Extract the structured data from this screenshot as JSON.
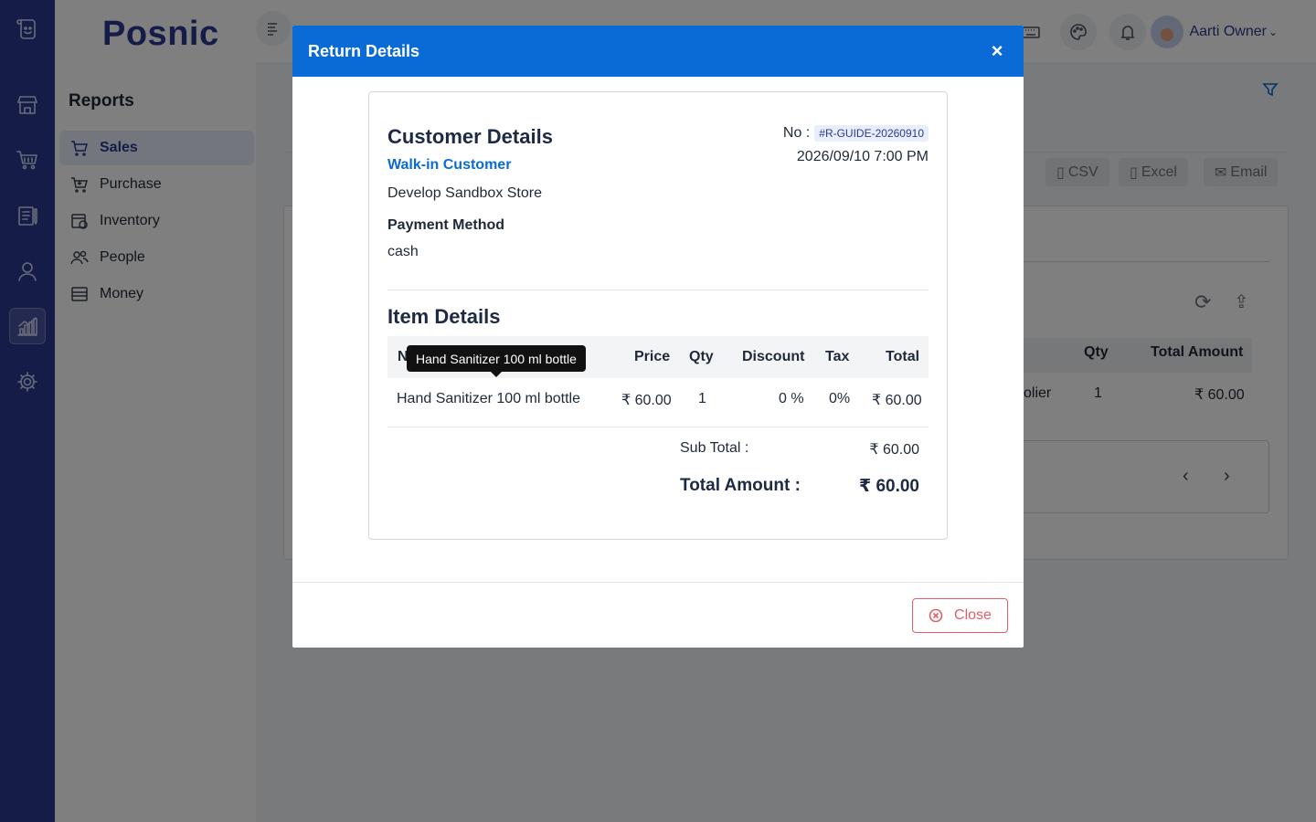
{
  "app": {
    "brand": "Posnic"
  },
  "rail": {
    "icons": [
      "document-logo-icon",
      "store-icon",
      "cart-icon",
      "clipboard-icon",
      "user-icon",
      "chart-icon",
      "gear-icon"
    ]
  },
  "sidebar": {
    "title": "Reports",
    "items": [
      {
        "label": "Sales",
        "icon": "cart-icon",
        "active": true
      },
      {
        "label": "Purchase",
        "icon": "basket-icon"
      },
      {
        "label": "Inventory",
        "icon": "inventory-icon"
      },
      {
        "label": "People",
        "icon": "people-icon"
      },
      {
        "label": "Money",
        "icon": "money-icon"
      }
    ]
  },
  "topbar": {
    "user_name": "Aarti Owner"
  },
  "background": {
    "export_buttons": [
      "CSV",
      "Excel",
      "Email"
    ],
    "table_headers": {
      "qty": "Qty",
      "total_amount": "Total Amount"
    },
    "row": {
      "partial_supplier": "olier",
      "qty": "1",
      "total_amount": "₹ 60.00"
    }
  },
  "modal": {
    "title": "Return Details",
    "close_x": "×",
    "customer": {
      "heading": "Customer Details",
      "name": "Walk-in Customer",
      "store": "Develop Sandbox Store",
      "payment_label": "Payment Method",
      "payment_value": "cash"
    },
    "number_label": "No :",
    "number": "#R-GUIDE-20260910",
    "datetime": "2026/09/10 7:00 PM",
    "items": {
      "heading": "Item Details",
      "columns": {
        "name": "N",
        "price": "Price",
        "qty": "Qty",
        "discount": "Discount",
        "tax": "Tax",
        "total": "Total"
      },
      "rows": [
        {
          "name": "Hand Sanitizer 100 ml bottle",
          "price": "₹ 60.00",
          "qty": "1",
          "discount": "0 %",
          "tax": "0%",
          "total": "₹ 60.00"
        }
      ],
      "tooltip": "Hand Sanitizer 100 ml bottle"
    },
    "summary": {
      "sub_total_label": "Sub Total :",
      "sub_total": "₹ 60.00",
      "total_label": "Total Amount :",
      "total": "₹ 60.00"
    },
    "footer": {
      "close_label": "Close"
    }
  }
}
